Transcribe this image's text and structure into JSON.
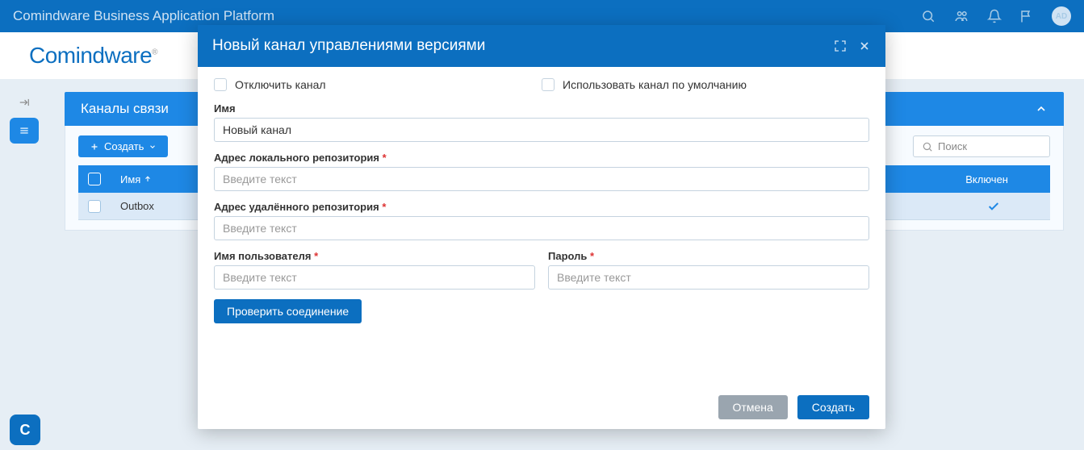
{
  "header": {
    "app_title": "Comindware Business Application Platform",
    "avatar": "AD"
  },
  "logo": "Comindware",
  "panel": {
    "title": "Каналы связи",
    "create_btn": "Создать",
    "search_placeholder": "Поиск",
    "columns": {
      "name": "Имя",
      "enabled": "Включен"
    },
    "rows": [
      {
        "name": "Outbox",
        "enabled": true
      }
    ]
  },
  "modal": {
    "title": "Новый канал управлениями версиями",
    "disable_channel": "Отключить канал",
    "use_default": "Использовать канал по умолчанию",
    "labels": {
      "name": "Имя",
      "local_repo": "Адрес локального репозитория",
      "remote_repo": "Адрес удалённого репозитория",
      "username": "Имя пользователя",
      "password": "Пароль"
    },
    "values": {
      "name": "Новый канал"
    },
    "placeholders": {
      "text": "Введите текст"
    },
    "test_conn": "Проверить соединение",
    "cancel": "Отмена",
    "create": "Создать"
  }
}
